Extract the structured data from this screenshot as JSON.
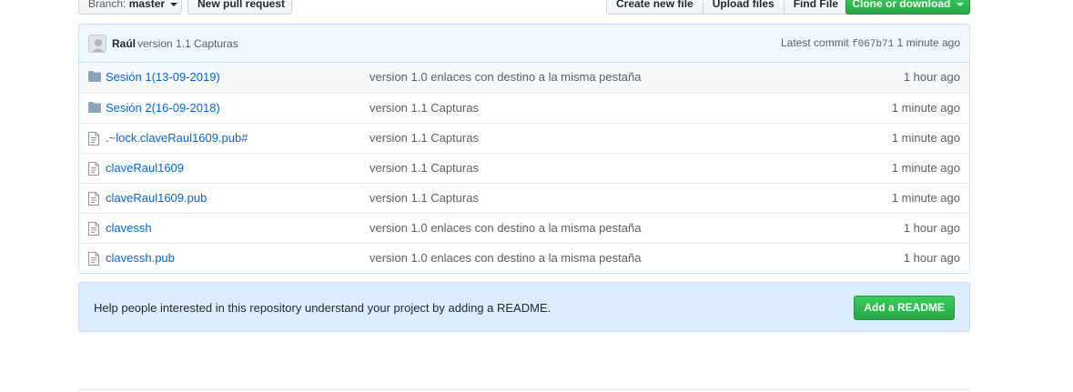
{
  "toolbar": {
    "branch_prefix": "Branch:",
    "branch_name": "master",
    "new_pr_label": "New pull request",
    "create_file_label": "Create new file",
    "upload_files_label": "Upload files",
    "find_file_label": "Find File",
    "clone_label": "Clone or download"
  },
  "commit": {
    "author": "Raúl",
    "message": "version 1.1 Capturas",
    "latest_label": "Latest commit",
    "sha": "f067b71",
    "time": "1 minute ago"
  },
  "files": [
    {
      "type": "folder",
      "name": "Sesión 1(13-09-2019)",
      "message": "version 1.0 enlaces con destino a la misma pestaña",
      "age": "1 hour ago"
    },
    {
      "type": "folder",
      "name": "Sesión 2(16-09-2018)",
      "message": "version 1.1 Capturas",
      "age": "1 minute ago"
    },
    {
      "type": "file",
      "name": ".~lock.claveRaul1609.pub#",
      "message": "version 1.1 Capturas",
      "age": "1 minute ago"
    },
    {
      "type": "file",
      "name": "claveRaul1609",
      "message": "version 1.1 Capturas",
      "age": "1 minute ago"
    },
    {
      "type": "file",
      "name": "claveRaul1609.pub",
      "message": "version 1.1 Capturas",
      "age": "1 minute ago"
    },
    {
      "type": "file",
      "name": "clavessh",
      "message": "version 1.0 enlaces con destino a la misma pestaña",
      "age": "1 hour ago"
    },
    {
      "type": "file",
      "name": "clavessh.pub",
      "message": "version 1.0 enlaces con destino a la misma pestaña",
      "age": "1 hour ago"
    }
  ],
  "readme": {
    "text": "Help people interested in this repository understand your project by adding a README.",
    "button_label": "Add a README"
  },
  "icons": {
    "folder": "folder-icon",
    "file": "file-icon",
    "caret": "caret-down-icon",
    "avatar": "avatar"
  },
  "colors": {
    "link": "#0366d6",
    "green": "#28a745",
    "commit_bg": "#f1f8ff",
    "readme_bg": "#dbedff",
    "folder": "#79b8ff"
  }
}
